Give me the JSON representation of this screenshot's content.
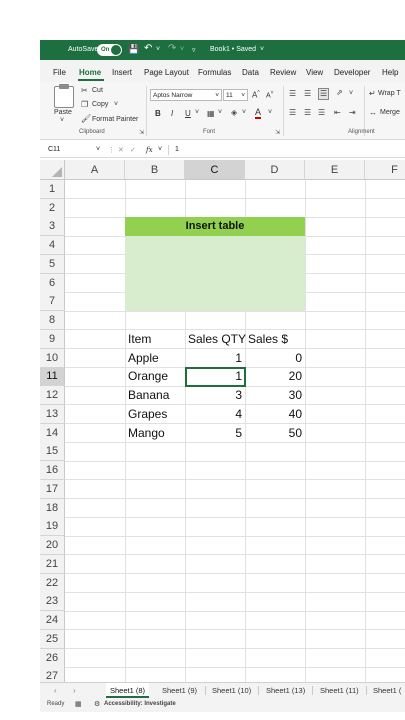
{
  "titlebar": {
    "autosave_label": "AutoSave",
    "autosave_state": "On",
    "doc_title": "Book1 • Saved",
    "bg_color": "#1e6f3f"
  },
  "menu": [
    "File",
    "Home",
    "Insert",
    "Page Layout",
    "Formulas",
    "Data",
    "Review",
    "View",
    "Developer",
    "Help"
  ],
  "menu_active": "Home",
  "ribbon": {
    "paste_label": "Paste",
    "cut_label": "Cut",
    "copy_label": "Copy",
    "format_painter_label": "Format Painter",
    "clipboard_group": "Clipboard",
    "font_name": "Aptos Narrow",
    "font_size": "11",
    "grow_font": "A^",
    "shrink_font": "A˅",
    "bold": "B",
    "italic": "I",
    "underline": "U",
    "font_color_glyph": "A",
    "font_group": "Font",
    "wrap_label": "Wrap T",
    "merge_label": "Merge",
    "alignment_group": "Alignment"
  },
  "formula_bar": {
    "name_box": "C11",
    "fx": "fx",
    "value": "1"
  },
  "grid": {
    "columns": [
      "A",
      "B",
      "C",
      "D",
      "E",
      "F"
    ],
    "rows": [
      "1",
      "2",
      "3",
      "4",
      "5",
      "6",
      "7",
      "8",
      "9",
      "10",
      "11",
      "12",
      "13",
      "14",
      "15",
      "16",
      "17",
      "18",
      "19",
      "20",
      "21",
      "22",
      "23",
      "24",
      "25",
      "26",
      "27"
    ],
    "selected_column": "C",
    "selected_row": "11",
    "insert_table_title": "Insert table",
    "insert_fill_header": "#92d050",
    "insert_fill_body": "#d8edcd",
    "headers": [
      "Item",
      "Sales QTY",
      "Sales $"
    ],
    "data": [
      {
        "item": "Apple",
        "qty": "1",
        "sales": "0"
      },
      {
        "item": "Orange",
        "qty": "1",
        "sales": "20"
      },
      {
        "item": "Banana",
        "qty": "3",
        "sales": "30"
      },
      {
        "item": "Grapes",
        "qty": "4",
        "sales": "40"
      },
      {
        "item": "Mango",
        "qty": "5",
        "sales": "50"
      }
    ]
  },
  "sheet_tabs": [
    "Sheet1 (8)",
    "Sheet1 (9)",
    "Sheet1 (10)",
    "Sheet1 (13)",
    "Sheet1 (11)",
    "Sheet1 ("
  ],
  "active_tab": "Sheet1 (8)",
  "status": {
    "ready": "Ready",
    "accessibility": "Accessibility: Investigate"
  }
}
